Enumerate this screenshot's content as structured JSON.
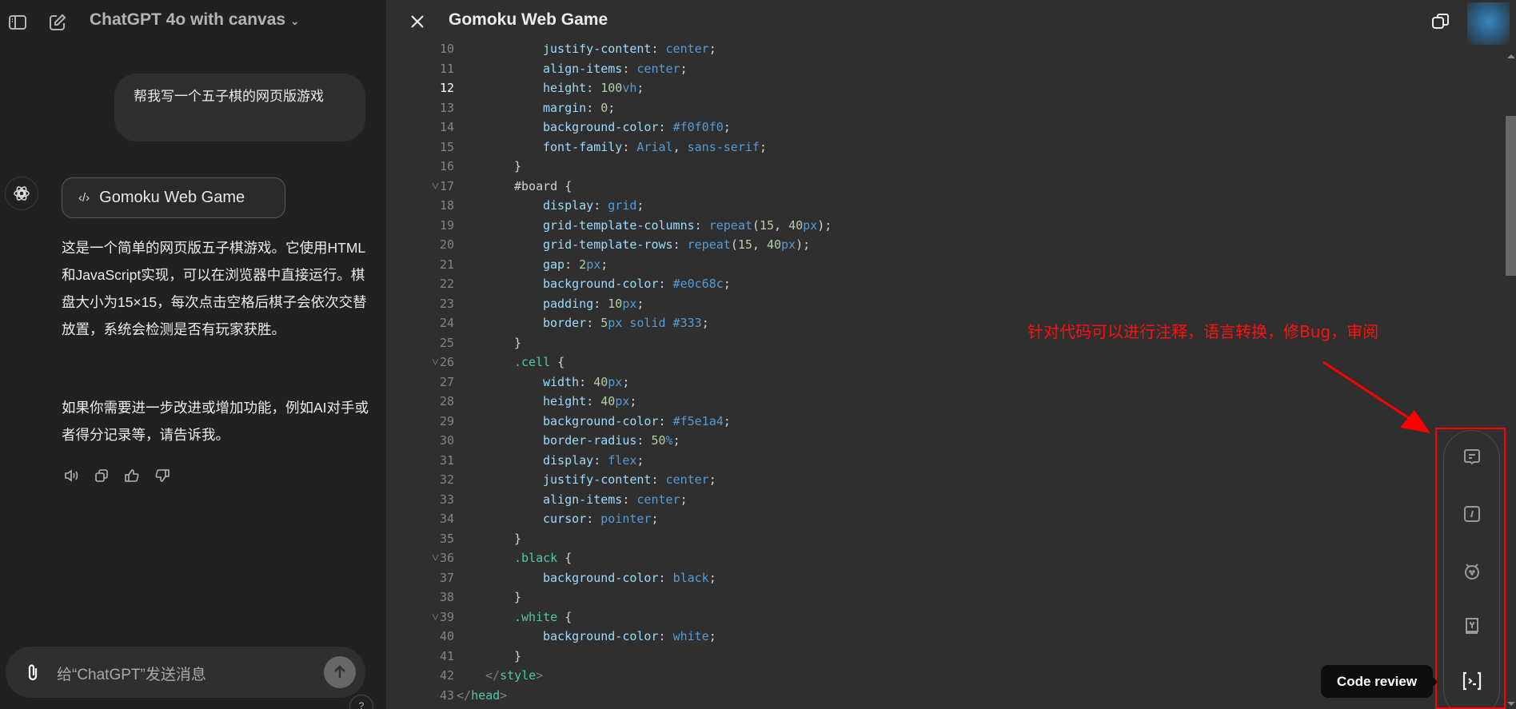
{
  "sidebar": {
    "model_title": "ChatGPT 4o with canvas",
    "user_message": "帮我写一个五子棋的网页版游戏",
    "canvas_button_label": "Gomoku Web Game",
    "paragraphs": [
      "这是一个简单的网页版五子棋游戏。它使用HTML和JavaScript实现，可以在浏览器中直接运行。棋盘大小为15×15，每次点击空格后棋子会依次交替放置，系统会检测是否有玩家获胜。",
      "如果你需要进一步改进或增加功能，例如AI对手或者得分记录等，请告诉我。"
    ],
    "input_placeholder": "给“ChatGPT”发送消息",
    "help_label": "?"
  },
  "canvas": {
    "title": "Gomoku Web Game",
    "current_line": 12,
    "lines": [
      {
        "n": 10,
        "d": 4,
        "t": [
          [
            "p",
            "justify-content"
          ],
          [
            "x",
            ": "
          ],
          [
            "v",
            "center"
          ],
          [
            "x",
            ";"
          ]
        ]
      },
      {
        "n": 11,
        "d": 4,
        "t": [
          [
            "p",
            "align-items"
          ],
          [
            "x",
            ": "
          ],
          [
            "v",
            "center"
          ],
          [
            "x",
            ";"
          ]
        ]
      },
      {
        "n": 12,
        "d": 4,
        "t": [
          [
            "p",
            "height"
          ],
          [
            "x",
            ": "
          ],
          [
            "n",
            "100"
          ],
          [
            "v",
            "vh"
          ],
          [
            "x",
            ";"
          ]
        ]
      },
      {
        "n": 13,
        "d": 4,
        "t": [
          [
            "p",
            "margin"
          ],
          [
            "x",
            ": "
          ],
          [
            "n",
            "0"
          ],
          [
            "x",
            ";"
          ]
        ]
      },
      {
        "n": 14,
        "d": 4,
        "t": [
          [
            "p",
            "background-color"
          ],
          [
            "x",
            ": "
          ],
          [
            "v",
            "#f0f0f0"
          ],
          [
            "x",
            ";"
          ]
        ]
      },
      {
        "n": 15,
        "d": 4,
        "t": [
          [
            "p",
            "font-family"
          ],
          [
            "x",
            ": "
          ],
          [
            "v",
            "Arial"
          ],
          [
            "x",
            ", "
          ],
          [
            "v",
            "sans-serif"
          ],
          [
            "x",
            ";"
          ]
        ]
      },
      {
        "n": 16,
        "d": 3,
        "t": [
          [
            "x",
            "}"
          ]
        ]
      },
      {
        "n": 17,
        "d": 3,
        "f": true,
        "t": [
          [
            "x",
            "#board {"
          ]
        ]
      },
      {
        "n": 18,
        "d": 4,
        "t": [
          [
            "p",
            "display"
          ],
          [
            "x",
            ": "
          ],
          [
            "v",
            "grid"
          ],
          [
            "x",
            ";"
          ]
        ]
      },
      {
        "n": 19,
        "d": 4,
        "t": [
          [
            "p",
            "grid-template-columns"
          ],
          [
            "x",
            ": "
          ],
          [
            "v",
            "repeat"
          ],
          [
            "x",
            "("
          ],
          [
            "n",
            "15"
          ],
          [
            "x",
            ", "
          ],
          [
            "n",
            "40"
          ],
          [
            "v",
            "px"
          ],
          [
            "x",
            ");"
          ]
        ]
      },
      {
        "n": 20,
        "d": 4,
        "t": [
          [
            "p",
            "grid-template-rows"
          ],
          [
            "x",
            ": "
          ],
          [
            "v",
            "repeat"
          ],
          [
            "x",
            "("
          ],
          [
            "n",
            "15"
          ],
          [
            "x",
            ", "
          ],
          [
            "n",
            "40"
          ],
          [
            "v",
            "px"
          ],
          [
            "x",
            ");"
          ]
        ]
      },
      {
        "n": 21,
        "d": 4,
        "t": [
          [
            "p",
            "gap"
          ],
          [
            "x",
            ": "
          ],
          [
            "n",
            "2"
          ],
          [
            "v",
            "px"
          ],
          [
            "x",
            ";"
          ]
        ]
      },
      {
        "n": 22,
        "d": 4,
        "t": [
          [
            "p",
            "background-color"
          ],
          [
            "x",
            ": "
          ],
          [
            "v",
            "#e0c68c"
          ],
          [
            "x",
            ";"
          ]
        ]
      },
      {
        "n": 23,
        "d": 4,
        "t": [
          [
            "p",
            "padding"
          ],
          [
            "x",
            ": "
          ],
          [
            "n",
            "10"
          ],
          [
            "v",
            "px"
          ],
          [
            "x",
            ";"
          ]
        ]
      },
      {
        "n": 24,
        "d": 4,
        "t": [
          [
            "p",
            "border"
          ],
          [
            "x",
            ": "
          ],
          [
            "n",
            "5"
          ],
          [
            "v",
            "px solid #333"
          ],
          [
            "x",
            ";"
          ]
        ]
      },
      {
        "n": 25,
        "d": 3,
        "t": [
          [
            "x",
            "}"
          ]
        ]
      },
      {
        "n": 26,
        "d": 3,
        "f": true,
        "t": [
          [
            "s",
            ".cell"
          ],
          [
            "x",
            " {"
          ]
        ]
      },
      {
        "n": 27,
        "d": 4,
        "t": [
          [
            "p",
            "width"
          ],
          [
            "x",
            ": "
          ],
          [
            "n",
            "40"
          ],
          [
            "v",
            "px"
          ],
          [
            "x",
            ";"
          ]
        ]
      },
      {
        "n": 28,
        "d": 4,
        "t": [
          [
            "p",
            "height"
          ],
          [
            "x",
            ": "
          ],
          [
            "n",
            "40"
          ],
          [
            "v",
            "px"
          ],
          [
            "x",
            ";"
          ]
        ]
      },
      {
        "n": 29,
        "d": 4,
        "t": [
          [
            "p",
            "background-color"
          ],
          [
            "x",
            ": "
          ],
          [
            "v",
            "#f5e1a4"
          ],
          [
            "x",
            ";"
          ]
        ]
      },
      {
        "n": 30,
        "d": 4,
        "t": [
          [
            "p",
            "border-radius"
          ],
          [
            "x",
            ": "
          ],
          [
            "n",
            "50"
          ],
          [
            "v",
            "%"
          ],
          [
            "x",
            ";"
          ]
        ]
      },
      {
        "n": 31,
        "d": 4,
        "t": [
          [
            "p",
            "display"
          ],
          [
            "x",
            ": "
          ],
          [
            "v",
            "flex"
          ],
          [
            "x",
            ";"
          ]
        ]
      },
      {
        "n": 32,
        "d": 4,
        "t": [
          [
            "p",
            "justify-content"
          ],
          [
            "x",
            ": "
          ],
          [
            "v",
            "center"
          ],
          [
            "x",
            ";"
          ]
        ]
      },
      {
        "n": 33,
        "d": 4,
        "t": [
          [
            "p",
            "align-items"
          ],
          [
            "x",
            ": "
          ],
          [
            "v",
            "center"
          ],
          [
            "x",
            ";"
          ]
        ]
      },
      {
        "n": 34,
        "d": 4,
        "t": [
          [
            "p",
            "cursor"
          ],
          [
            "x",
            ": "
          ],
          [
            "v",
            "pointer"
          ],
          [
            "x",
            ";"
          ]
        ]
      },
      {
        "n": 35,
        "d": 3,
        "t": [
          [
            "x",
            "}"
          ]
        ]
      },
      {
        "n": 36,
        "d": 3,
        "f": true,
        "t": [
          [
            "s",
            ".black"
          ],
          [
            "x",
            " {"
          ]
        ]
      },
      {
        "n": 37,
        "d": 4,
        "t": [
          [
            "p",
            "background-color"
          ],
          [
            "x",
            ": "
          ],
          [
            "v",
            "black"
          ],
          [
            "x",
            ";"
          ]
        ]
      },
      {
        "n": 38,
        "d": 3,
        "t": [
          [
            "x",
            "}"
          ]
        ]
      },
      {
        "n": 39,
        "d": 3,
        "f": true,
        "t": [
          [
            "s",
            ".white"
          ],
          [
            "x",
            " {"
          ]
        ]
      },
      {
        "n": 40,
        "d": 4,
        "t": [
          [
            "p",
            "background-color"
          ],
          [
            "x",
            ": "
          ],
          [
            "v",
            "white"
          ],
          [
            "x",
            ";"
          ]
        ]
      },
      {
        "n": 41,
        "d": 3,
        "t": [
          [
            "x",
            "}"
          ]
        ]
      },
      {
        "n": 42,
        "d": 2,
        "t": [
          [
            "g",
            "</"
          ],
          [
            "s",
            "style"
          ],
          [
            "g",
            ">"
          ]
        ]
      },
      {
        "n": 43,
        "d": 1,
        "t": [
          [
            "g",
            "</"
          ],
          [
            "s",
            "head"
          ],
          [
            "g",
            ">"
          ]
        ]
      }
    ]
  },
  "annotation": {
    "text": "针对代码可以进行注释，语言转换，修Bug，审阅",
    "color": "#ff0000"
  },
  "toolbar": {
    "tools": [
      "comment-icon",
      "language-icon",
      "bug-icon",
      "logs-icon",
      "code-review-icon"
    ],
    "tooltip": "Code review"
  }
}
